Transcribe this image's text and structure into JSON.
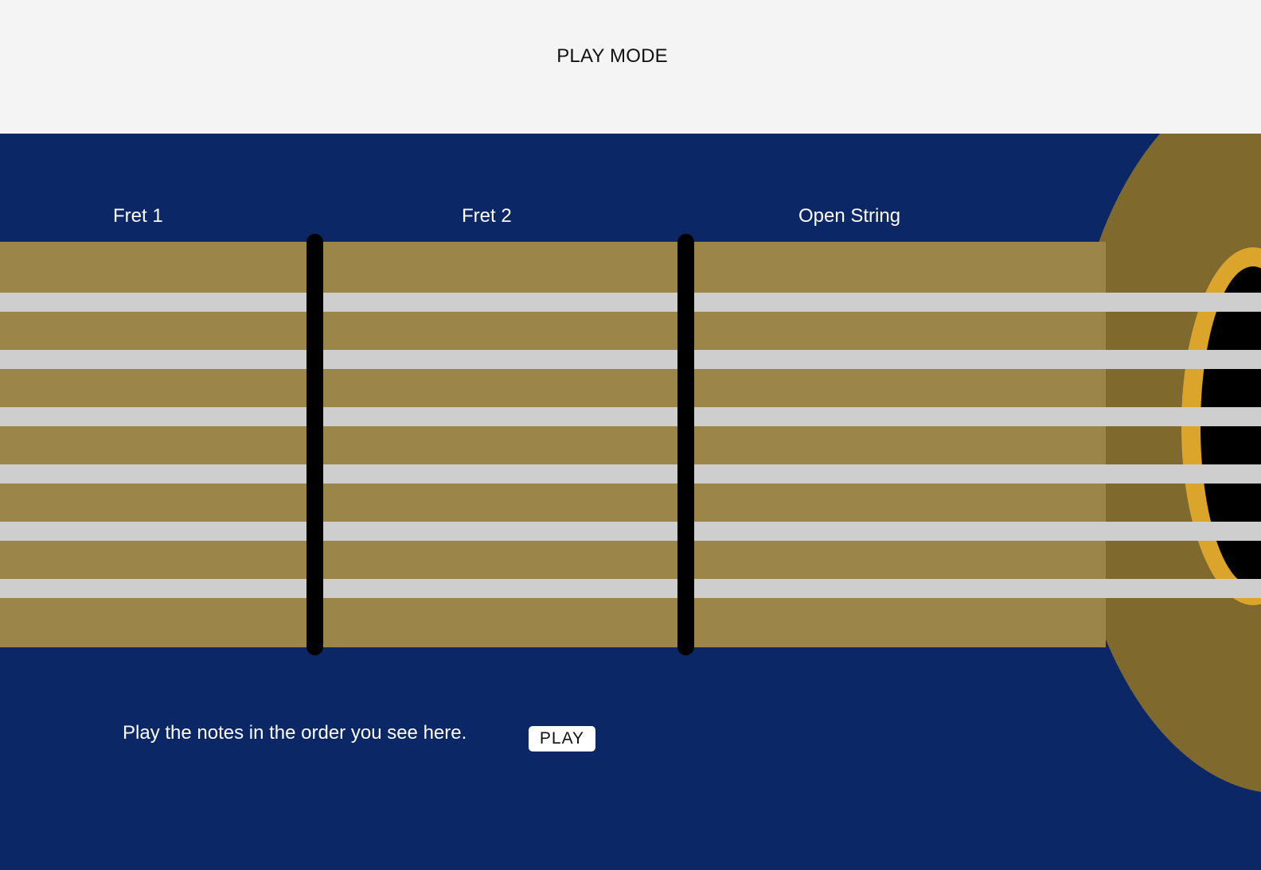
{
  "header": {
    "title": "PLAY MODE"
  },
  "fretboard": {
    "labels": [
      "Fret 1",
      "Fret 2",
      "Open String"
    ],
    "string_count": 6,
    "fret_count": 2
  },
  "footer": {
    "instructions": "Play the notes in the order you see here.",
    "play_label": "PLAY"
  },
  "colors": {
    "header_bg": "#f4f4f4",
    "stage_bg": "#0b2765",
    "neck": "#9c8548",
    "guitar_body": "#7f692c",
    "sound_hole_ring": "#daa52a",
    "strings": "#cecece",
    "frets": "#000000"
  }
}
